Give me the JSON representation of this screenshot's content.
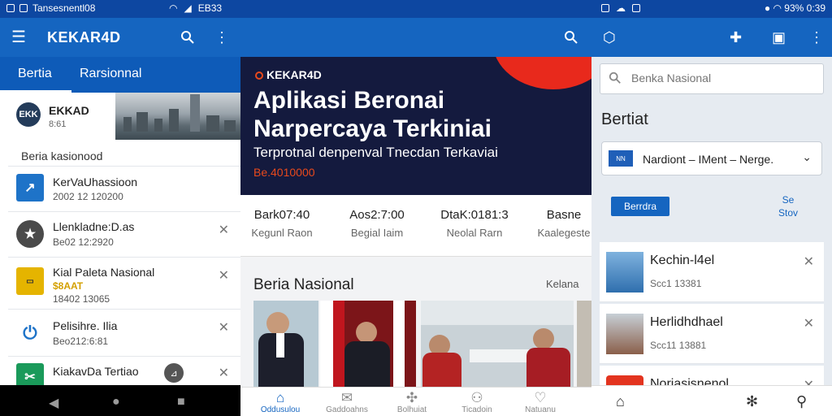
{
  "status": {
    "left_text": "Tansesnentl08",
    "signal_text": "EB33",
    "right_text": "93%",
    "time": "0:39"
  },
  "appbar_left": {
    "title": "KEKAR4D",
    "menu_icon": "menu-icon",
    "search_icon": "search-icon",
    "more_icon": "more-vert-icon"
  },
  "tabs": [
    {
      "label": "Bertia"
    },
    {
      "label": "Rarsionnal"
    }
  ],
  "hero_card": {
    "logo": "EKK",
    "name": "EKKAD",
    "sub": "8:61"
  },
  "left_section": "Beria kasionood",
  "left_items": [
    {
      "title": "KerVaUhassioon",
      "date": "2002 12 120200",
      "color": "#1e73c8",
      "icon": "arrow-icon"
    },
    {
      "title": "Llenkladne:D.as",
      "date": "Be02 12:2920",
      "color": "#4a4a4a",
      "icon": "star-icon"
    },
    {
      "title": "Kial Paleta Nasional",
      "date": "18402 13065",
      "sub": "$8AAT",
      "color": "#e5b400",
      "icon": "ticket-icon"
    },
    {
      "title": "Pelisihre. Ilia",
      "date": "Beo212:6:81",
      "color": "#1e73c8",
      "icon": "power-icon"
    },
    {
      "title": "KiakavDa Tertiao",
      "date": "",
      "color": "#1a9a5a",
      "icon": "expand-icon"
    }
  ],
  "banner": {
    "brand": "KEKAR4D",
    "headline_1": "Aplikasi Beronai",
    "headline_2": "Narpercaya Terkiniai",
    "subhead": "Terprotnal denpenval Tnecdan Terkaviai",
    "tagline": "Be.4010000"
  },
  "stats": [
    {
      "value": "Bark07:40",
      "label": "Kegunl Raon"
    },
    {
      "value": "Aos2:7:00",
      "label": "Begial Iaim"
    },
    {
      "value": "DtaK:0181:3",
      "label": "Neolal Rarn"
    },
    {
      "value": "Basne",
      "label": "Kaalegeste"
    }
  ],
  "section": {
    "title": "Beria Nasional",
    "link": "Kelana"
  },
  "bottom_nav": [
    {
      "label": "Oddusulou",
      "icon": "home-icon"
    },
    {
      "label": "Gaddoahns",
      "icon": "mail-icon"
    },
    {
      "label": "Bolhuiat",
      "icon": "puzzle-icon"
    },
    {
      "label": "Ticadoin",
      "icon": "group-icon"
    },
    {
      "label": "Natuanu",
      "icon": "heart-icon"
    }
  ],
  "right_panel": {
    "search_placeholder": "Benka Nasional",
    "title": "Bertiat",
    "select_value": "Nardiont – IMent – Nerge.",
    "select_flag": "NN",
    "button": "Berrdra",
    "side_label_1": "Se",
    "side_label_2": "Stov",
    "items": [
      {
        "title": "Kechin-l4el",
        "date": "Scc1 13381",
        "icon": "bridge-icon"
      },
      {
        "title": "Herlidhdhael",
        "date": "Scc11 13881",
        "icon": "building-icon"
      },
      {
        "title": "Noriasisnenol",
        "date": "",
        "icon": "badge-icon"
      }
    ]
  },
  "colors": {
    "primary": "#1565c0",
    "banner_bg": "#141a3e",
    "accent": "#e8291c"
  }
}
